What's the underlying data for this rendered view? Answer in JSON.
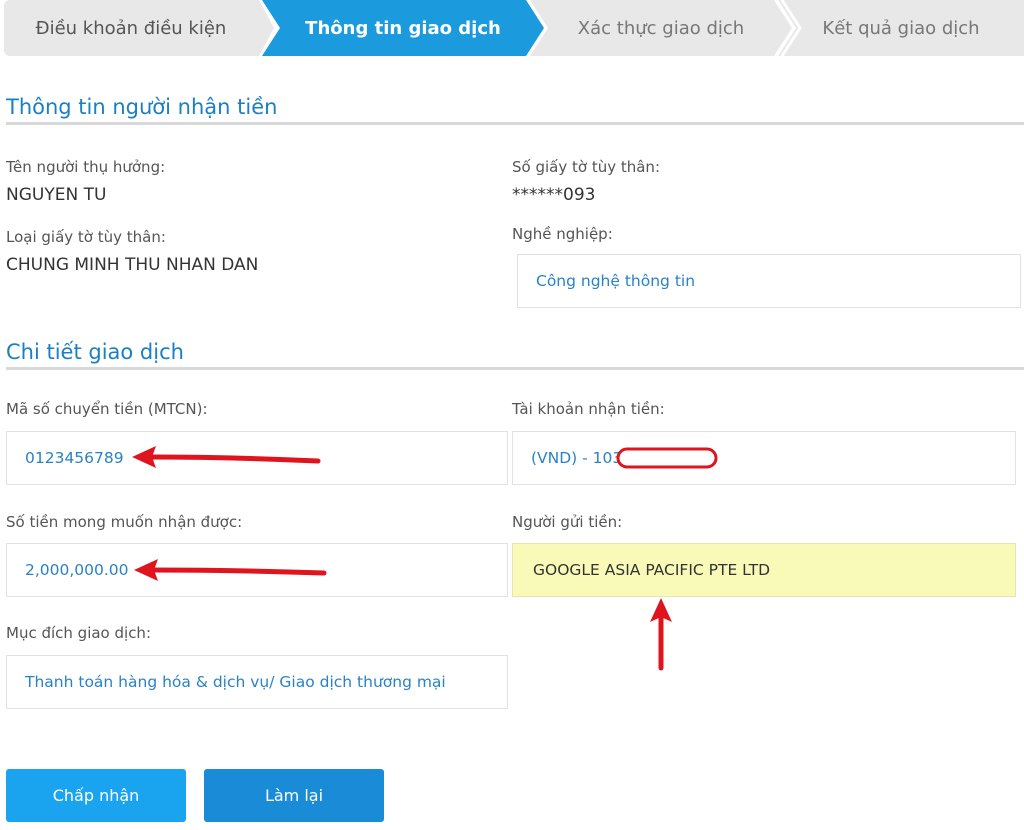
{
  "steps": [
    {
      "label": "Điều khoản điều kiện"
    },
    {
      "label": "Thông tin giao dịch"
    },
    {
      "label": "Xác thực giao dịch"
    },
    {
      "label": "Kết quả giao dịch"
    }
  ],
  "recipient_section": {
    "title": "Thông tin người nhận tiền",
    "beneficiary_label": "Tên người thụ hưởng:",
    "beneficiary_value": "NGUYEN TU",
    "id_number_label": "Số giấy tờ tùy thân:",
    "id_number_value": "******093",
    "id_type_label": "Loại giấy tờ tùy thân:",
    "id_type_value": "CHUNG MINH THU NHAN DAN",
    "occupation_label": "Nghề nghiệp:",
    "occupation_value": "Công nghệ thông tin"
  },
  "transaction_section": {
    "title": "Chi tiết giao dịch",
    "mtcn_label": "Mã số chuyển tiền (MTCN):",
    "mtcn_value": "0123456789",
    "account_label": "Tài khoản nhận tiền:",
    "account_value": "(VND) - 103",
    "amount_label": "Số tiền mong muốn nhận được:",
    "amount_value": "2,000,000.00",
    "sender_label": "Người gửi tiền:",
    "sender_value": "GOOGLE ASIA PACIFIC PTE LTD",
    "purpose_label": "Mục đích giao dịch:",
    "purpose_value": "Thanh toán hàng hóa & dịch vụ/ Giao dịch thương mại"
  },
  "buttons": {
    "accept_label": "Chấp nhận",
    "reset_label": "Làm lại"
  },
  "colors": {
    "accent": "#1b9bde",
    "annotation_red": "#e0141e",
    "highlight": "#fafab8"
  }
}
